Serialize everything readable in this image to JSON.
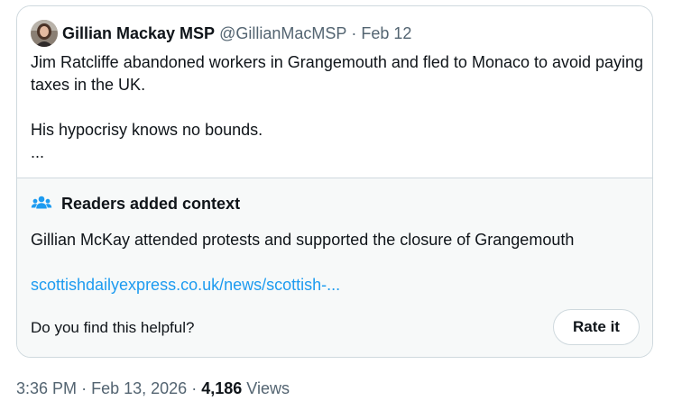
{
  "quoted_tweet": {
    "author_name": "Gillian Mackay MSP",
    "handle": "@GillianMacMSP",
    "separator": "·",
    "date": "Feb 12",
    "text_lines": [
      "Jim Ratcliffe abandoned workers in Grangemouth and fled to Monaco to avoid paying taxes in the UK.",
      "His hypocrisy knows no bounds.",
      "..."
    ],
    "avatar_icon": "profile-photo"
  },
  "community_note": {
    "icon": "people-icon",
    "title": "Readers added context",
    "note_text": "Gillian McKay attended protests and supported the closure of Grangemouth",
    "link_text": "scottishdailyexpress.co.uk/news/scottish-...",
    "question": "Do you find this helpful?",
    "rate_label": "Rate it"
  },
  "tweet_meta": {
    "time": "3:36 PM",
    "separator": "·",
    "date": "Feb 13, 2026",
    "views_count": "4,186",
    "views_label": "Views"
  },
  "colors": {
    "text_primary": "#0f1419",
    "text_secondary": "#536471",
    "link": "#1d9bf0",
    "border": "#cfd9de",
    "note_background": "#f7f9f9"
  }
}
